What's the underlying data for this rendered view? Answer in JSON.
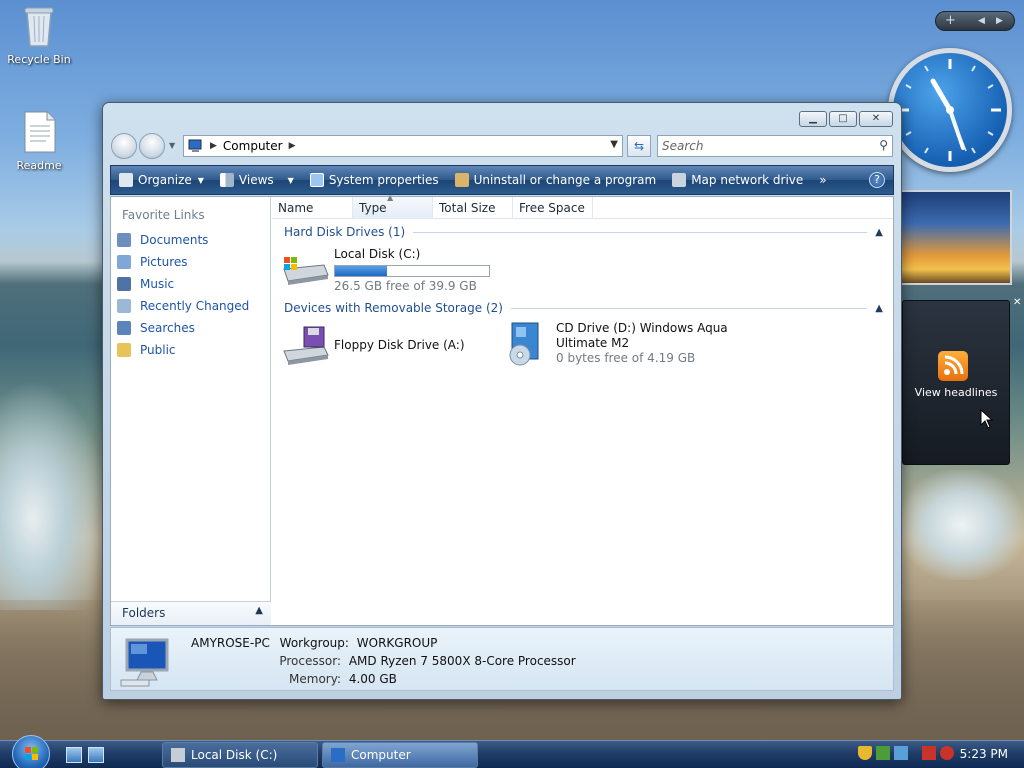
{
  "desktop": {
    "recycle_bin": "Recycle Bin",
    "readme": "Readme"
  },
  "gadgets": {
    "feed_label": "View headlines"
  },
  "window": {
    "address": "Computer",
    "search_placeholder": "Search",
    "toolbar": {
      "organize": "Organize",
      "views": "Views",
      "system_properties": "System properties",
      "uninstall": "Uninstall or change a program",
      "map_drive": "Map network drive",
      "more": "»",
      "help": "?"
    },
    "nav": {
      "heading": "Favorite Links",
      "items": [
        "Documents",
        "Pictures",
        "Music",
        "Recently Changed",
        "Searches",
        "Public"
      ],
      "folders": "Folders"
    },
    "columns": [
      "Name",
      "Type",
      "Total Size",
      "Free Space"
    ],
    "groups": {
      "hdd": "Hard Disk Drives (1)",
      "removable": "Devices with Removable Storage (2)"
    },
    "drives": {
      "c_name": "Local Disk (C:)",
      "c_free": "26.5 GB free of 39.9 GB",
      "c_used_fraction": 0.34,
      "a_name": "Floppy Disk Drive (A:)",
      "d_name_line1": "CD Drive (D:) Windows Aqua",
      "d_name_line2": "Ultimate M2",
      "d_free": "0 bytes free of 4.19 GB"
    },
    "details": {
      "pc_name": "AMYROSE-PC",
      "workgroup_label": "Workgroup:",
      "workgroup": "WORKGROUP",
      "processor_label": "Processor:",
      "processor": "AMD Ryzen 7 5800X 8-Core Processor",
      "memory_label": "Memory:",
      "memory": "4.00 GB"
    }
  },
  "taskbar": {
    "buttons": [
      "Local Disk (C:)",
      "Computer"
    ],
    "time": "5:23 PM"
  },
  "colors": {
    "link_blue": "#1c55a8",
    "toolbar_blue": "#2f5a8d",
    "capacity_fill": "#1e67c5"
  }
}
